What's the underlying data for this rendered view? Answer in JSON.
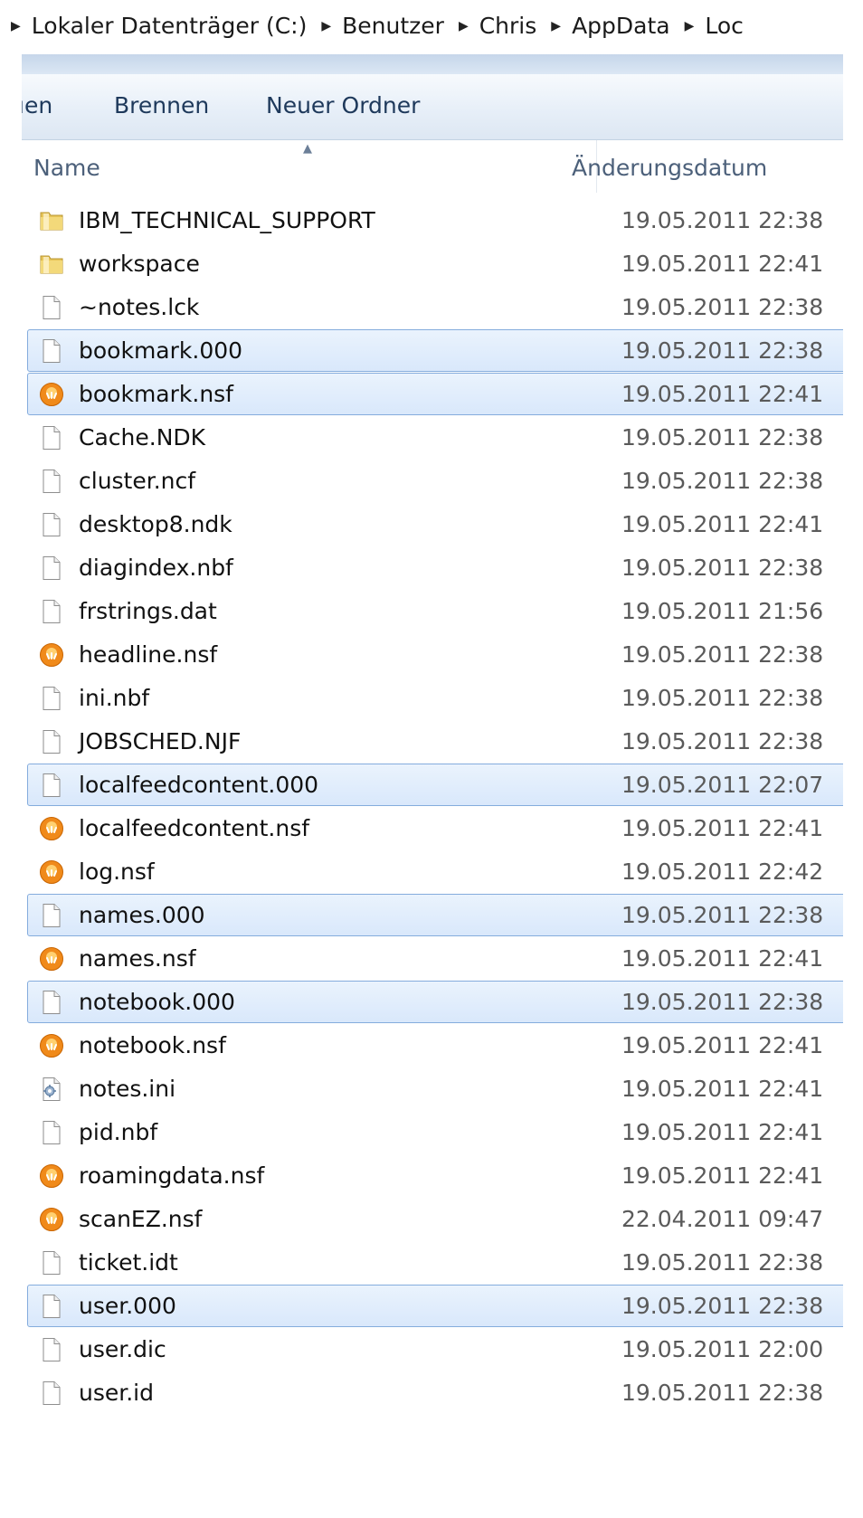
{
  "breadcrumb": [
    "Lokaler Datenträger (C:)",
    "Benutzer",
    "Chris",
    "AppData",
    "Loc"
  ],
  "toolbar": {
    "partial_button": "ıen",
    "burn": "Brennen",
    "new_folder": "Neuer Ordner"
  },
  "columns": {
    "name": "Name",
    "date": "Änderungsdatum"
  },
  "files": [
    {
      "name": "IBM_TECHNICAL_SUPPORT",
      "date": "19.05.2011 22:38",
      "icon": "folder-icon",
      "selected": false
    },
    {
      "name": "workspace",
      "date": "19.05.2011 22:41",
      "icon": "folder-icon",
      "selected": false
    },
    {
      "name": "~notes.lck",
      "date": "19.05.2011 22:38",
      "icon": "file-icon",
      "selected": false
    },
    {
      "name": "bookmark.000",
      "date": "19.05.2011 22:38",
      "icon": "file-icon",
      "selected": true
    },
    {
      "name": "bookmark.nsf",
      "date": "19.05.2011 22:41",
      "icon": "notes-db-icon",
      "selected": true
    },
    {
      "name": "Cache.NDK",
      "date": "19.05.2011 22:38",
      "icon": "file-icon",
      "selected": false
    },
    {
      "name": "cluster.ncf",
      "date": "19.05.2011 22:38",
      "icon": "file-icon",
      "selected": false
    },
    {
      "name": "desktop8.ndk",
      "date": "19.05.2011 22:41",
      "icon": "file-icon",
      "selected": false
    },
    {
      "name": "diagindex.nbf",
      "date": "19.05.2011 22:38",
      "icon": "file-icon",
      "selected": false
    },
    {
      "name": "frstrings.dat",
      "date": "19.05.2011 21:56",
      "icon": "file-icon",
      "selected": false
    },
    {
      "name": "headline.nsf",
      "date": "19.05.2011 22:38",
      "icon": "notes-db-icon",
      "selected": false
    },
    {
      "name": "ini.nbf",
      "date": "19.05.2011 22:38",
      "icon": "file-icon",
      "selected": false
    },
    {
      "name": "JOBSCHED.NJF",
      "date": "19.05.2011 22:38",
      "icon": "file-icon",
      "selected": false
    },
    {
      "name": "localfeedcontent.000",
      "date": "19.05.2011 22:07",
      "icon": "file-icon",
      "selected": true
    },
    {
      "name": "localfeedcontent.nsf",
      "date": "19.05.2011 22:41",
      "icon": "notes-db-icon",
      "selected": false
    },
    {
      "name": "log.nsf",
      "date": "19.05.2011 22:42",
      "icon": "notes-db-icon",
      "selected": false
    },
    {
      "name": "names.000",
      "date": "19.05.2011 22:38",
      "icon": "file-icon",
      "selected": true
    },
    {
      "name": "names.nsf",
      "date": "19.05.2011 22:41",
      "icon": "notes-db-icon",
      "selected": false
    },
    {
      "name": "notebook.000",
      "date": "19.05.2011 22:38",
      "icon": "file-icon",
      "selected": true
    },
    {
      "name": "notebook.nsf",
      "date": "19.05.2011 22:41",
      "icon": "notes-db-icon",
      "selected": false
    },
    {
      "name": "notes.ini",
      "date": "19.05.2011 22:41",
      "icon": "config-file-icon",
      "selected": false
    },
    {
      "name": "pid.nbf",
      "date": "19.05.2011 22:41",
      "icon": "file-icon",
      "selected": false
    },
    {
      "name": "roamingdata.nsf",
      "date": "19.05.2011 22:41",
      "icon": "notes-db-icon",
      "selected": false
    },
    {
      "name": "scanEZ.nsf",
      "date": "22.04.2011 09:47",
      "icon": "notes-db-icon",
      "selected": false
    },
    {
      "name": "ticket.idt",
      "date": "19.05.2011 22:38",
      "icon": "file-icon",
      "selected": false
    },
    {
      "name": "user.000",
      "date": "19.05.2011 22:38",
      "icon": "file-icon",
      "selected": true
    },
    {
      "name": "user.dic",
      "date": "19.05.2011 22:00",
      "icon": "file-icon",
      "selected": false
    },
    {
      "name": "user.id",
      "date": "19.05.2011 22:38",
      "icon": "file-icon",
      "selected": false
    }
  ]
}
